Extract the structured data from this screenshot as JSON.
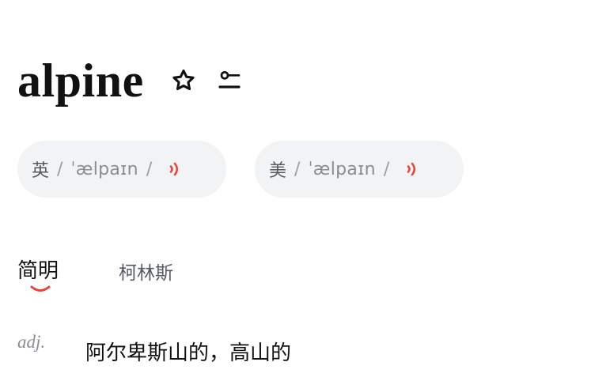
{
  "entry": {
    "word": "alpine"
  },
  "pronunciations": [
    {
      "region": "英",
      "slash_open": "/",
      "ipa": "ˈælpaɪn",
      "slash_close": "/"
    },
    {
      "region": "美",
      "slash_open": "/",
      "ipa": "ˈælpaɪn",
      "slash_close": "/"
    }
  ],
  "tabs": [
    {
      "label": "简明",
      "active": true
    },
    {
      "label": "柯林斯",
      "active": false
    }
  ],
  "definitions": [
    {
      "pos": "adj.",
      "meaning": "阿尔卑斯山的，高山的"
    }
  ],
  "colors": {
    "accent": "#e8453c",
    "pill_bg": "#f2f3f5",
    "text_primary": "#111111",
    "text_secondary": "#8a8d94"
  },
  "icons": {
    "favorite": "star-outline-icon",
    "wordbook": "add-to-list-icon",
    "audio": "speaker-wave-icon"
  }
}
